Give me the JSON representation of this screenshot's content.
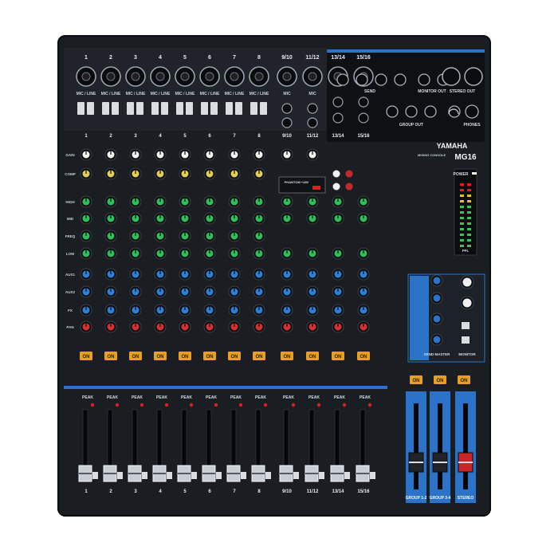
{
  "brand": "YAMAHA",
  "model": "MG16",
  "model_caption": "MIXING CONSOLE",
  "mono_channels": [
    "1",
    "2",
    "3",
    "4",
    "5",
    "6",
    "7",
    "8"
  ],
  "stereo_channels": [
    "9/10",
    "11/12",
    "13/14",
    "15/16"
  ],
  "labels": {
    "mic_line": "MIC / LINE",
    "mic": "MIC",
    "on": "ON",
    "peak": "PEAK",
    "send": "SEND",
    "monitor_out": "MONITOR OUT",
    "stereo_out": "STEREO OUT",
    "group_out": "GROUP OUT",
    "phones": "PHONES",
    "phantom": "PHANTOM +48V",
    "power": "POWER",
    "pfl": "PFL",
    "group_12": "GROUP 1-2",
    "group_34": "GROUP 3-4",
    "stereo": "STEREO",
    "send_master": "SEND MASTER",
    "monitor": "MONITOR"
  },
  "knob_rows": [
    {
      "name": "gain",
      "label": "GAIN",
      "color": "#f2f2f2"
    },
    {
      "name": "comp",
      "label": "COMP",
      "color": "#e0d05a"
    },
    {
      "name": "hi",
      "label": "HIGH",
      "color": "#2fbf5a"
    },
    {
      "name": "mid",
      "label": "MID",
      "color": "#2fbf5a"
    },
    {
      "name": "freq",
      "label": "FREQ",
      "color": "#2fbf5a"
    },
    {
      "name": "low",
      "label": "LOW",
      "color": "#2fbf5a"
    },
    {
      "name": "aux1",
      "label": "AUX1",
      "color": "#2e7fd8"
    },
    {
      "name": "aux2",
      "label": "AUX2",
      "color": "#2e7fd8"
    },
    {
      "name": "fx",
      "label": "FX",
      "color": "#2e7fd8"
    },
    {
      "name": "pan",
      "label": "PAN",
      "color": "#d83030"
    }
  ],
  "colors": {
    "panel": "#1a1d22",
    "blue_accent": "#2a73c8",
    "on_button": "#e8a020",
    "peak_led": "#e02020",
    "meter_green": "#3ec05a"
  }
}
